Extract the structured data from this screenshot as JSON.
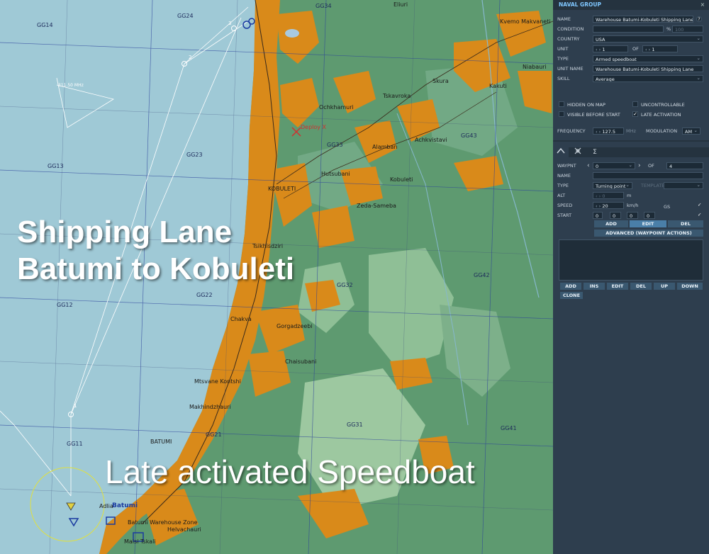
{
  "map": {
    "grid_labels": [
      "GG14",
      "GG24",
      "GG34",
      "GG13",
      "GG23",
      "GG33",
      "GG43",
      "GG12",
      "GG22",
      "GG32",
      "GG42",
      "GG11",
      "GG21",
      "GG31",
      "GG41"
    ],
    "towns": [
      "Eliuri",
      "Kvemo Makvaneti",
      "Niabauri",
      "Skura",
      "Kakuti",
      "Tskavroka",
      "Ochkhamuri",
      "Achkvistavi",
      "Alamban",
      "Hutsubani",
      "Kobuleti",
      "KOBULETI",
      "Zeda-Sameba",
      "Tsikhisdziri",
      "Chakva",
      "Gorgadzeebi",
      "Chaisubani",
      "Mtsvane Kontshi",
      "Makhindzhauri",
      "BATUMI",
      "Batumi",
      "Adlia",
      "Batumi Warehouse Zone",
      "Helvachauri",
      "Maisi Tskali",
      "Deploy X"
    ],
    "frequency_label": "311.50 MHz",
    "waypoint_numbers": [
      "1",
      "2",
      "3"
    ]
  },
  "overlay": {
    "line1": "Shipping Lane",
    "line2": "Batumi to Kobuleti",
    "line3": "Late activated Speedboat"
  },
  "panel": {
    "title": "NAVAL GROUP",
    "close": "×",
    "name_label": "NAME",
    "name_value": "Warehouse Batumi-Kobuleti Shipping Lane",
    "help": "?",
    "condition_label": "CONDITION",
    "condition_pct": "%",
    "condition_value": "100",
    "country_label": "COUNTRY",
    "country_value": "USA",
    "unit_label": "UNIT",
    "unit_value": "1",
    "unit_of": "OF",
    "unit_total": "1",
    "type_label": "TYPE",
    "type_value": "Armed speedboat",
    "unit_name_label": "UNIT NAME",
    "unit_name_value": "Warehouse Batumi-Kobuleti Shipping Lane",
    "skill_label": "SKILL",
    "skill_value": "Average",
    "hidden_on_map": "HIDDEN ON MAP",
    "uncontrollable": "UNCONTROLLABLE",
    "visible_before_start": "VISIBLE BEFORE START",
    "late_activation": "LATE ACTIVATION",
    "late_activation_checked": true,
    "frequency_label": "FREQUENCY",
    "frequency_value": "127.5",
    "frequency_unit": "MHz",
    "modulation_label": "MODULATION",
    "modulation_value": "AM",
    "tabs": [
      "route-icon",
      "targets-icon",
      "Σ"
    ],
    "waypoint_label": "WAYPNT",
    "waypoint_value": "0",
    "waypoint_of": "OF",
    "waypoint_total": "4",
    "wp_name_label": "NAME",
    "wp_type_label": "TYPE",
    "wp_type_value": "Turning point",
    "template_label": "TEMPLATE",
    "alt_label": "ALT",
    "alt_value": "0",
    "alt_unit": "m",
    "speed_label": "SPEED",
    "speed_value": "20",
    "speed_unit": "km/h",
    "gs_label": "GS",
    "start_label": "START",
    "start_d": "0",
    "start_h": "0",
    "start_m": "0",
    "start_s": "0",
    "btn_add": "ADD",
    "btn_edit": "EDIT",
    "btn_del": "DEL",
    "btn_advanced": "ADVANCED (WAYPOINT ACTIONS)",
    "list_buttons": [
      "ADD",
      "INS",
      "EDIT",
      "DEL",
      "UP",
      "DOWN"
    ],
    "btn_clone": "CLONE"
  },
  "colors": {
    "sea": "#9fc9d6",
    "land": "#5e9a70",
    "urban": "#d98a1a",
    "panel_bg": "#2e3e4e",
    "accent": "#7fc7ff"
  }
}
